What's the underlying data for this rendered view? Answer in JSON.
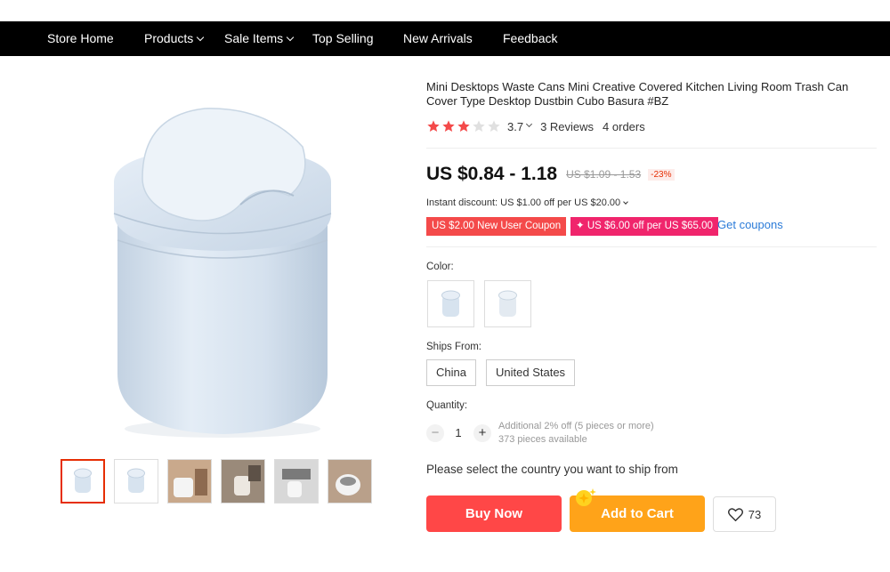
{
  "nav": {
    "items": [
      {
        "label": "Store Home"
      },
      {
        "label": "Products"
      },
      {
        "label": "Sale Items"
      },
      {
        "label": "Top Selling"
      },
      {
        "label": "New Arrivals"
      },
      {
        "label": "Feedback"
      }
    ]
  },
  "product": {
    "title": "Mini Desktops Waste Cans Mini Creative Covered Kitchen Living Room Trash Can Cover Type Desktop Dustbin Cubo Basura #BZ",
    "rating": "3.7",
    "rating_value": 3.7,
    "rating_max": 5,
    "reviews": "3 Reviews",
    "orders": "4 orders",
    "price": "US $0.84 - 1.18",
    "old_price": "US $1.09 - 1.53",
    "discount": "-23%",
    "instant_discount": "Instant discount: US $1.00 off per US $20.00",
    "coupons": [
      "US $2.00 New User Coupon",
      "✦ US $6.00 off per US $65.00"
    ],
    "get_coupons": "Get coupons"
  },
  "options": {
    "color_label": "Color:",
    "ships_from_label": "Ships From:",
    "ships_from": [
      "China",
      "United States"
    ],
    "quantity_label": "Quantity:",
    "quantity": "1",
    "qty_minus": "−",
    "qty_plus": "+",
    "additional_discount": "Additional 2% off (5 pieces or more)",
    "available": "373 pieces available",
    "ship_note": "Please select the country you want to ship from"
  },
  "actions": {
    "buy_now": "Buy Now",
    "add_to_cart": "Add to Cart",
    "wishlist_count": "73"
  },
  "colors": {
    "nav_bg": "#000000",
    "buy_now": "#ff4747",
    "add_to_cart": "#ffa319",
    "star": "#f44a4a",
    "coupon_red": "#f44a4a",
    "coupon_pink": "#f0256c",
    "link": "#2b7bd8",
    "product": "#d7e3ef"
  },
  "icons": {
    "nav_chevrons": "chevron-down-icon",
    "stars": "star-icon",
    "wishlist": "heart-icon",
    "cart_badge": "sparkle-icon"
  }
}
